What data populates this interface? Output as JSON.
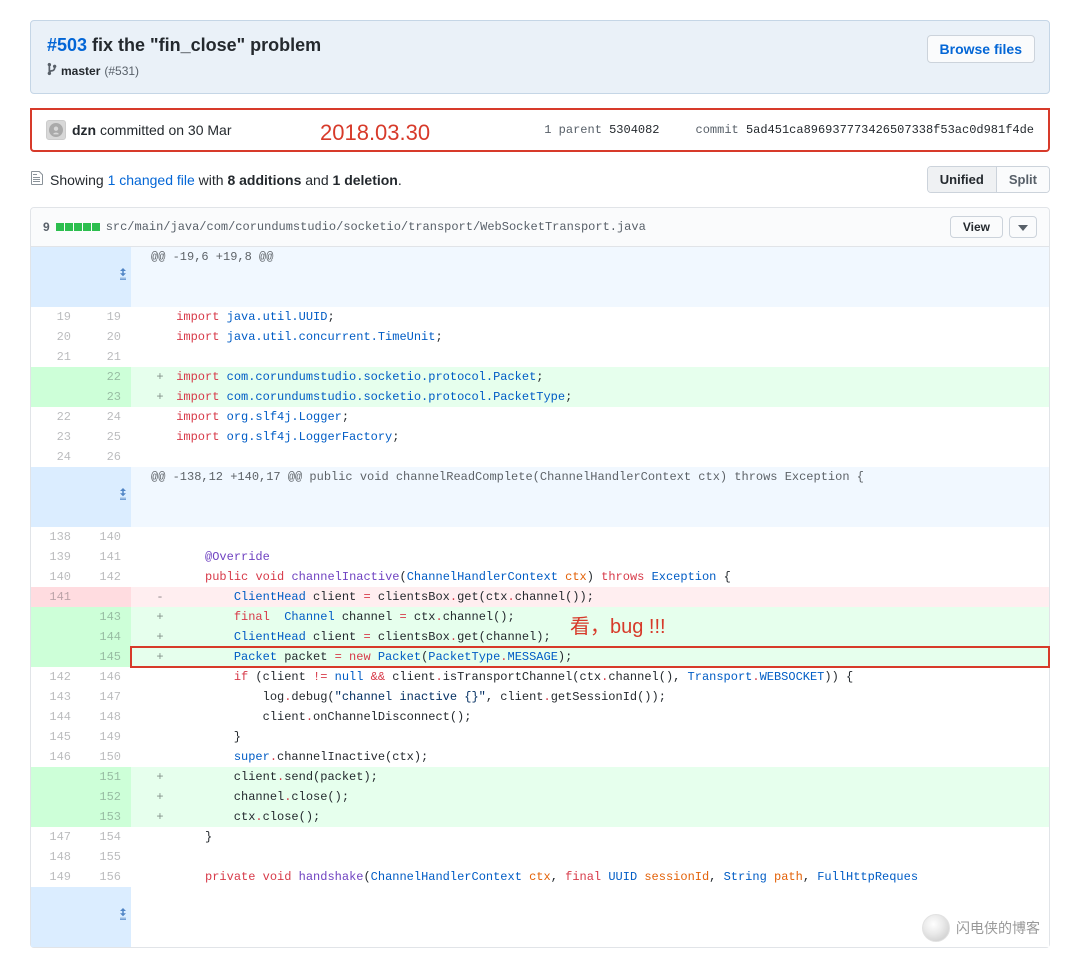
{
  "commit": {
    "issue_link": "#503",
    "title_rest": " fix the \"fin_close\" problem",
    "branch": "master",
    "branch_suffix": "(#531)",
    "browse_btn": "Browse files",
    "author": "dzn",
    "committed_text": " committed on 30 Mar",
    "parent_label": "1 parent ",
    "parent_sha": "5304082",
    "commit_label": "commit ",
    "commit_sha": "5ad451ca896937773426507338f53ac0d981f4de"
  },
  "annotations": {
    "date": "2018.03.30",
    "bug": "看，bug !!!"
  },
  "summary": {
    "prefix": "Showing ",
    "changed": "1 changed file",
    "mid": " with ",
    "additions": "8 additions",
    "and": " and ",
    "deletions": "1 deletion",
    "suffix": "."
  },
  "toggles": {
    "unified": "Unified",
    "split": "Split"
  },
  "file": {
    "diff_count": "9",
    "path": "src/main/java/com/corundumstudio/socketio/transport/WebSocketTransport.java",
    "view_btn": "View"
  },
  "hunks": {
    "h1": "@@ -19,6 +19,8 @@",
    "h2": "@@ -138,12 +140,17 @@ public void channelReadComplete(ChannelHandlerContext ctx) throws Exception {"
  },
  "watermark": "闪电侠的博客"
}
